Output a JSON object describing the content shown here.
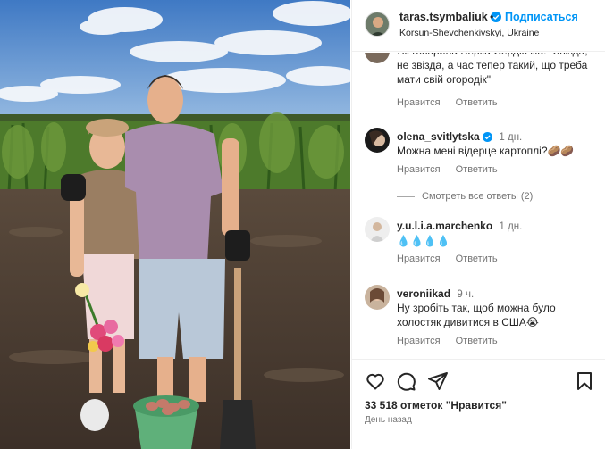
{
  "post": {
    "username": "taras.tsymbaliuk",
    "follow_label": "Подписаться",
    "location": "Korsun-Shevchenkivskyi, Ukraine"
  },
  "comments": [
    {
      "username": "",
      "time": "",
      "text": "Як говорила Верка Сердючка: \"Звіздa, не звізда, а час тепер такий, що треба мати свій огородік\"",
      "like_label": "Нравится",
      "reply_label": "Ответить"
    },
    {
      "username": "olena_svitlytska",
      "verified": true,
      "time": "1 дн.",
      "text": "Можна мені відерце картоплі?🥔🥔",
      "like_label": "Нравится",
      "reply_label": "Ответить"
    },
    {
      "username": "y.u.l.i.a.marchenko",
      "time": "1 дн.",
      "text": "💧💧💧💧",
      "like_label": "Нравится",
      "reply_label": "Ответить"
    },
    {
      "username": "veroniikad",
      "time": "9 ч.",
      "text": "Ну зробіть так, щоб можна було холостяк дивитися в США😭",
      "like_label": "Нравится",
      "reply_label": "Ответить"
    }
  ],
  "view_replies_label": "Смотреть все ответы (2)",
  "likes_text": "33 518 отметок \"Нравится\"",
  "date_text": "День назад",
  "icons": {
    "like": "heart-outline-icon",
    "comment": "comment-bubble-icon",
    "share": "paper-plane-icon",
    "save": "bookmark-icon",
    "verified": "verified-badge-icon"
  },
  "colors": {
    "accent": "#0095f6",
    "text": "#262626",
    "muted": "#737373",
    "border": "#efefef"
  }
}
